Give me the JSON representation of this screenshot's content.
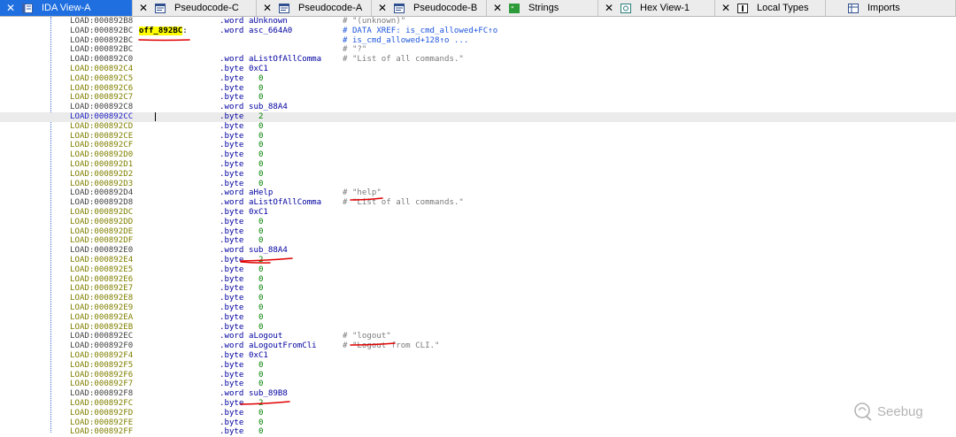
{
  "tabs": [
    {
      "label": "IDA View-A",
      "icon": "ida-view-icon",
      "active": true,
      "has_close": true
    },
    {
      "label": "Pseudocode-C",
      "icon": "pseudocode-icon",
      "active": false,
      "has_close": true
    },
    {
      "label": "Pseudocode-A",
      "icon": "pseudocode-icon",
      "active": false,
      "has_close": true
    },
    {
      "label": "Pseudocode-B",
      "icon": "pseudocode-icon",
      "active": false,
      "has_close": true
    },
    {
      "label": "Strings",
      "icon": "strings-icon",
      "active": false,
      "has_close": true
    },
    {
      "label": "Hex View-1",
      "icon": "hex-view-icon",
      "active": false,
      "has_close": true
    },
    {
      "label": "Local Types",
      "icon": "local-types-icon",
      "active": false,
      "has_close": true
    },
    {
      "label": "Imports",
      "icon": "imports-icon",
      "active": false,
      "has_close": false
    }
  ],
  "lines": [
    {
      "addr": "LOAD:000892B8",
      "ac": "n",
      "label": "",
      "instr": ".word",
      "operand": "aUnknown",
      "comment": "# \"(unknown)\"",
      "cc": ""
    },
    {
      "addr": "LOAD:000892BC",
      "ac": "n",
      "label": "off_892BC",
      "label_suffix": ":",
      "instr": ".word",
      "operand": "asc_664A0",
      "comment": "# DATA XREF: is_cmd_allowed+FC↑o",
      "cc": "x"
    },
    {
      "addr": "LOAD:000892BC",
      "ac": "n",
      "label": "",
      "instr": "",
      "operand": "",
      "comment": "# is_cmd_allowed+128↑o ...",
      "cc": "x"
    },
    {
      "addr": "LOAD:000892BC",
      "ac": "n",
      "label": "",
      "instr": "",
      "operand": "",
      "comment": "# \"?\"",
      "cc": ""
    },
    {
      "addr": "LOAD:000892C0",
      "ac": "n",
      "label": "",
      "instr": ".word",
      "operand": "aListOfAllComma",
      "comment": "# \"List of all commands.\"",
      "cc": ""
    },
    {
      "addr": "LOAD:000892C4",
      "ac": "o",
      "label": "",
      "instr": ".byte",
      "operand": "0xC1",
      "comment": "",
      "cc": ""
    },
    {
      "addr": "LOAD:000892C5",
      "ac": "o",
      "label": "",
      "instr": ".byte",
      "operand": "  0",
      "comment": "",
      "cc": ""
    },
    {
      "addr": "LOAD:000892C6",
      "ac": "o",
      "label": "",
      "instr": ".byte",
      "operand": "  0",
      "comment": "",
      "cc": ""
    },
    {
      "addr": "LOAD:000892C7",
      "ac": "o",
      "label": "",
      "instr": ".byte",
      "operand": "  0",
      "comment": "",
      "cc": ""
    },
    {
      "addr": "LOAD:000892C8",
      "ac": "n",
      "label": "",
      "instr": ".word",
      "operand": "sub_88A4",
      "comment": "",
      "cc": ""
    },
    {
      "addr": "LOAD:000892CC",
      "ac": "s",
      "label": "",
      "instr": ".byte",
      "operand": "  2",
      "comment": "",
      "cc": "",
      "hl": true
    },
    {
      "addr": "LOAD:000892CD",
      "ac": "o",
      "label": "",
      "instr": ".byte",
      "operand": "  0",
      "comment": "",
      "cc": ""
    },
    {
      "addr": "LOAD:000892CE",
      "ac": "o",
      "label": "",
      "instr": ".byte",
      "operand": "  0",
      "comment": "",
      "cc": ""
    },
    {
      "addr": "LOAD:000892CF",
      "ac": "o",
      "label": "",
      "instr": ".byte",
      "operand": "  0",
      "comment": "",
      "cc": ""
    },
    {
      "addr": "LOAD:000892D0",
      "ac": "o",
      "label": "",
      "instr": ".byte",
      "operand": "  0",
      "comment": "",
      "cc": ""
    },
    {
      "addr": "LOAD:000892D1",
      "ac": "o",
      "label": "",
      "instr": ".byte",
      "operand": "  0",
      "comment": "",
      "cc": ""
    },
    {
      "addr": "LOAD:000892D2",
      "ac": "o",
      "label": "",
      "instr": ".byte",
      "operand": "  0",
      "comment": "",
      "cc": ""
    },
    {
      "addr": "LOAD:000892D3",
      "ac": "o",
      "label": "",
      "instr": ".byte",
      "operand": "  0",
      "comment": "",
      "cc": ""
    },
    {
      "addr": "LOAD:000892D4",
      "ac": "n",
      "label": "",
      "instr": ".word",
      "operand": "aHelp",
      "comment": "# \"help\"",
      "cc": ""
    },
    {
      "addr": "LOAD:000892D8",
      "ac": "n",
      "label": "",
      "instr": ".word",
      "operand": "aListOfAllComma",
      "comment": "# \"List of all commands.\"",
      "cc": ""
    },
    {
      "addr": "LOAD:000892DC",
      "ac": "o",
      "label": "",
      "instr": ".byte",
      "operand": "0xC1",
      "comment": "",
      "cc": ""
    },
    {
      "addr": "LOAD:000892DD",
      "ac": "o",
      "label": "",
      "instr": ".byte",
      "operand": "  0",
      "comment": "",
      "cc": ""
    },
    {
      "addr": "LOAD:000892DE",
      "ac": "o",
      "label": "",
      "instr": ".byte",
      "operand": "  0",
      "comment": "",
      "cc": ""
    },
    {
      "addr": "LOAD:000892DF",
      "ac": "o",
      "label": "",
      "instr": ".byte",
      "operand": "  0",
      "comment": "",
      "cc": ""
    },
    {
      "addr": "LOAD:000892E0",
      "ac": "n",
      "label": "",
      "instr": ".word",
      "operand": "sub_88A4",
      "comment": "",
      "cc": ""
    },
    {
      "addr": "LOAD:000892E4",
      "ac": "o",
      "label": "",
      "instr": ".byte",
      "operand": "  2",
      "comment": "",
      "cc": ""
    },
    {
      "addr": "LOAD:000892E5",
      "ac": "o",
      "label": "",
      "instr": ".byte",
      "operand": "  0",
      "comment": "",
      "cc": ""
    },
    {
      "addr": "LOAD:000892E6",
      "ac": "o",
      "label": "",
      "instr": ".byte",
      "operand": "  0",
      "comment": "",
      "cc": ""
    },
    {
      "addr": "LOAD:000892E7",
      "ac": "o",
      "label": "",
      "instr": ".byte",
      "operand": "  0",
      "comment": "",
      "cc": ""
    },
    {
      "addr": "LOAD:000892E8",
      "ac": "o",
      "label": "",
      "instr": ".byte",
      "operand": "  0",
      "comment": "",
      "cc": ""
    },
    {
      "addr": "LOAD:000892E9",
      "ac": "o",
      "label": "",
      "instr": ".byte",
      "operand": "  0",
      "comment": "",
      "cc": ""
    },
    {
      "addr": "LOAD:000892EA",
      "ac": "o",
      "label": "",
      "instr": ".byte",
      "operand": "  0",
      "comment": "",
      "cc": ""
    },
    {
      "addr": "LOAD:000892EB",
      "ac": "o",
      "label": "",
      "instr": ".byte",
      "operand": "  0",
      "comment": "",
      "cc": ""
    },
    {
      "addr": "LOAD:000892EC",
      "ac": "n",
      "label": "",
      "instr": ".word",
      "operand": "aLogout",
      "comment": "# \"logout\"",
      "cc": ""
    },
    {
      "addr": "LOAD:000892F0",
      "ac": "n",
      "label": "",
      "instr": ".word",
      "operand": "aLogoutFromCli",
      "comment": "# \"Logout from CLI.\"",
      "cc": ""
    },
    {
      "addr": "LOAD:000892F4",
      "ac": "o",
      "label": "",
      "instr": ".byte",
      "operand": "0xC1",
      "comment": "",
      "cc": ""
    },
    {
      "addr": "LOAD:000892F5",
      "ac": "o",
      "label": "",
      "instr": ".byte",
      "operand": "  0",
      "comment": "",
      "cc": ""
    },
    {
      "addr": "LOAD:000892F6",
      "ac": "o",
      "label": "",
      "instr": ".byte",
      "operand": "  0",
      "comment": "",
      "cc": ""
    },
    {
      "addr": "LOAD:000892F7",
      "ac": "o",
      "label": "",
      "instr": ".byte",
      "operand": "  0",
      "comment": "",
      "cc": ""
    },
    {
      "addr": "LOAD:000892F8",
      "ac": "n",
      "label": "",
      "instr": ".word",
      "operand": "sub_89B8",
      "comment": "",
      "cc": ""
    },
    {
      "addr": "LOAD:000892FC",
      "ac": "o",
      "label": "",
      "instr": ".byte",
      "operand": "  2",
      "comment": "",
      "cc": ""
    },
    {
      "addr": "LOAD:000892FD",
      "ac": "o",
      "label": "",
      "instr": ".byte",
      "operand": "  0",
      "comment": "",
      "cc": ""
    },
    {
      "addr": "LOAD:000892FE",
      "ac": "o",
      "label": "",
      "instr": ".byte",
      "operand": "  0",
      "comment": "",
      "cc": ""
    },
    {
      "addr": "LOAD:000892FF",
      "ac": "o",
      "label": "",
      "instr": ".byte",
      "operand": "  0",
      "comment": "",
      "cc": ""
    }
  ],
  "watermark": {
    "text": "Seebug",
    "icon": "seebug-logo-icon"
  },
  "colors": {
    "tab_active": "#1f6fe0",
    "highlight": "#ffff00",
    "annotation": "#e00000"
  }
}
